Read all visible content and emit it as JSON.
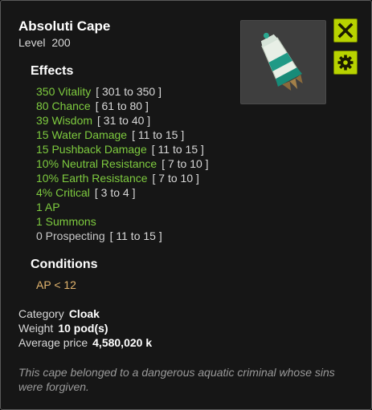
{
  "item": {
    "name": "Absoluti Cape",
    "level_label": "Level",
    "level": "200",
    "image_icon": "cape-item-icon"
  },
  "actions": {
    "close_icon": "close-x-icon",
    "settings_icon": "gear-icon"
  },
  "effects": {
    "heading": "Effects",
    "items": [
      {
        "text": "350 Vitality",
        "range": "[ 301 to 350 ]",
        "active": true
      },
      {
        "text": "80 Chance",
        "range": "[ 61 to 80 ]",
        "active": true
      },
      {
        "text": "39 Wisdom",
        "range": "[ 31 to 40 ]",
        "active": true
      },
      {
        "text": "15 Water Damage",
        "range": "[ 11 to 15 ]",
        "active": true
      },
      {
        "text": "15 Pushback Damage",
        "range": "[ 11 to 15 ]",
        "active": true
      },
      {
        "text": "10% Neutral Resistance",
        "range": "[ 7 to 10 ]",
        "active": true
      },
      {
        "text": "10% Earth Resistance",
        "range": "[ 7 to 10 ]",
        "active": true
      },
      {
        "text": "4% Critical",
        "range": "[ 3 to 4 ]",
        "active": true
      },
      {
        "text": "1 AP",
        "range": "",
        "active": true
      },
      {
        "text": "1 Summons",
        "range": "",
        "active": true
      },
      {
        "text": "0 Prospecting",
        "range": "[ 11 to 15 ]",
        "active": false
      }
    ]
  },
  "conditions": {
    "heading": "Conditions",
    "items": [
      "AP < 12"
    ]
  },
  "info": {
    "category_label": "Category",
    "category": "Cloak",
    "weight_label": "Weight",
    "weight": "10 pod(s)",
    "price_label": "Average price",
    "price": "4,580,020 k"
  },
  "description": "This cape belonged to a dangerous aquatic criminal whose sins were forgiven.",
  "colors": {
    "accent": "#b8d300",
    "effect_active": "#7ecb3f",
    "effect_inactive": "#c8c8c8",
    "condition": "#e3b56e",
    "description": "#9a9a9a"
  }
}
